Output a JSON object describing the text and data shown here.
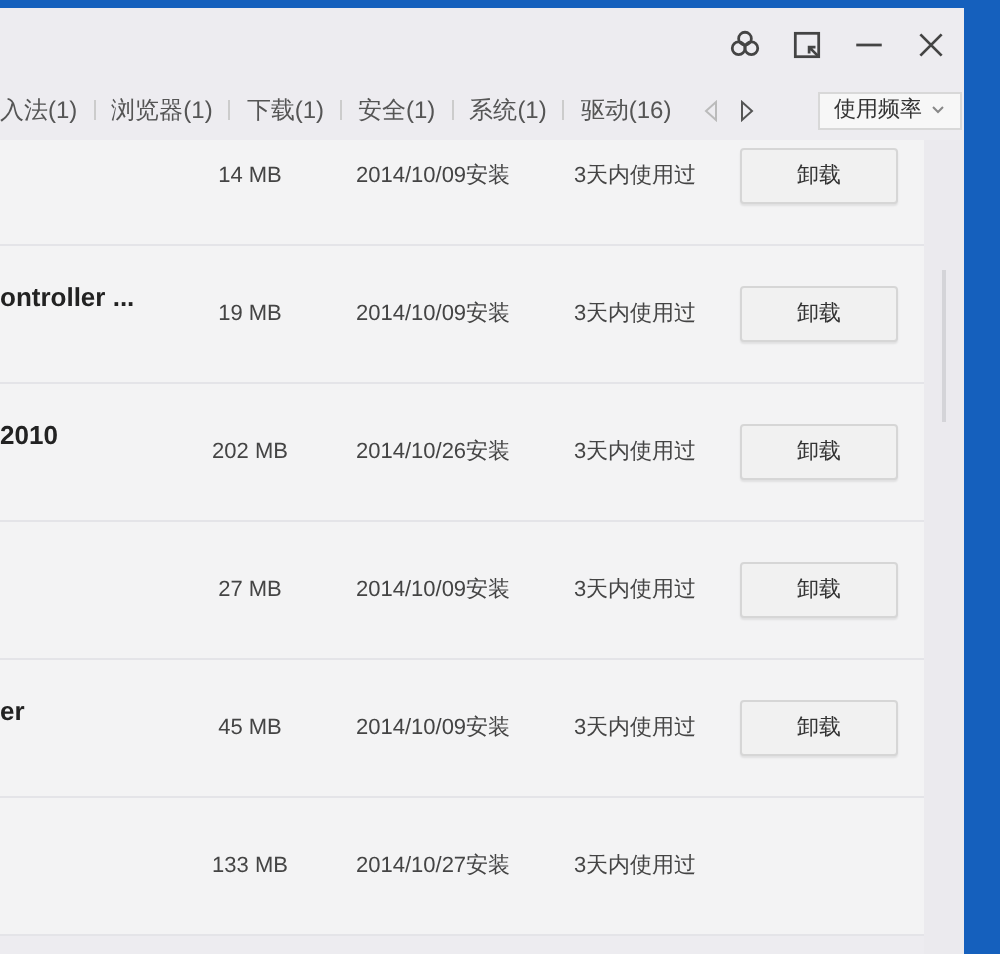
{
  "tabs": [
    {
      "label": "入法(1)",
      "selected": false
    },
    {
      "label": "浏览器(1)",
      "selected": false
    },
    {
      "label": "下载(1)",
      "selected": false
    },
    {
      "label": "安全(1)",
      "selected": false
    },
    {
      "label": "系统(1)",
      "selected": false
    },
    {
      "label": "驱动(16)",
      "selected": false
    }
  ],
  "sort": {
    "value": "使用频率"
  },
  "rows": [
    {
      "size": "14 MB",
      "date": "2014/10/09安装",
      "usage": "3天内使用过",
      "button": "卸载"
    },
    {
      "name": "ontroller ...",
      "size": "19 MB",
      "date": "2014/10/09安装",
      "usage": "3天内使用过",
      "button": "卸载"
    },
    {
      "name": "2010",
      "size": "202 MB",
      "date": "2014/10/26安装",
      "usage": "3天内使用过",
      "button": "卸载"
    },
    {
      "size": "27 MB",
      "date": "2014/10/09安装",
      "usage": "3天内使用过",
      "button": "卸载"
    },
    {
      "name": "er",
      "size": "45 MB",
      "date": "2014/10/09安装",
      "usage": "3天内使用过",
      "button": "卸载"
    },
    {
      "size": "133 MB",
      "date": "2014/10/27安装",
      "usage": "3天内使用过"
    }
  ]
}
